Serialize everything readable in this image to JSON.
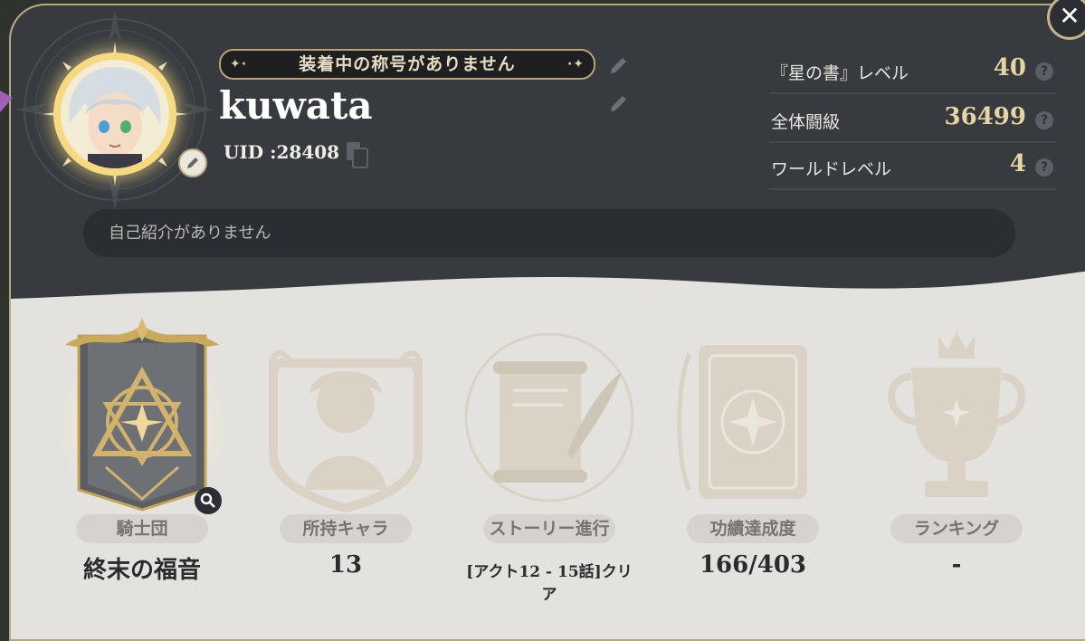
{
  "profile": {
    "title_text": "装着中の称号がありません",
    "username": "kuwata",
    "uid": "UID :28408",
    "intro_placeholder": "自己紹介がありません"
  },
  "stats": [
    {
      "label": "『星の書』レベル",
      "value": "40"
    },
    {
      "label": "全体闘級",
      "value": "36499"
    },
    {
      "label": "ワールドレベル",
      "value": "4"
    }
  ],
  "sections": [
    {
      "label": "騎士団",
      "value": "終末の福音"
    },
    {
      "label": "所持キャラ",
      "value": "13"
    },
    {
      "label": "ストーリー進行",
      "value": "[アクト12 - 15話]クリア"
    },
    {
      "label": "功績達成度",
      "value": "166/403"
    },
    {
      "label": "ランキング",
      "value": "-"
    }
  ],
  "icons": {
    "close": "close-icon",
    "edit": "pencil-icon",
    "copy": "copy-icon",
    "help": "question-icon",
    "zoom": "magnifier-icon"
  },
  "colors": {
    "dark_panel": "#373b40",
    "light_panel": "#e4e2df",
    "gold": "#e7d4a5",
    "border": "#b9a782"
  }
}
